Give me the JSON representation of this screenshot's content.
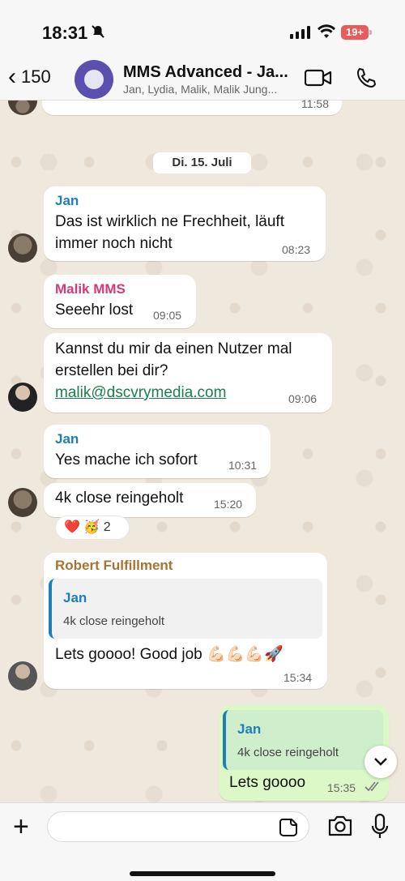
{
  "status": {
    "time": "18:31",
    "battery": "19+"
  },
  "header": {
    "back_count": "150",
    "title": "MMS Advanced - Ja...",
    "subtitle": "Jan, Lydia, Malik, Malik Jung..."
  },
  "top_partial": {
    "time": "11:58"
  },
  "date_chip": "Di. 15. Juli",
  "messages": [
    {
      "sender": "Jan",
      "sender_color": "#1f7fb5",
      "lines": [
        "Das ist wirklich ne Frechheit, läuft",
        "immer noch nicht"
      ],
      "time": "08:23"
    },
    {
      "sender": "Malik MMS",
      "sender_color": "#d13a7a",
      "lines": [
        "Seeehr lost"
      ],
      "time": "09:05"
    },
    {
      "lines": [
        "Kannst du mir da einen Nutzer mal",
        "erstellen bei dir?"
      ],
      "link": "malik@dscvrymedia.com",
      "time": "09:06"
    },
    {
      "sender": "Jan",
      "sender_color": "#1f7fb5",
      "lines": [
        "Yes mache ich sofort"
      ],
      "time": "10:31"
    },
    {
      "lines": [
        "4k close reingeholt"
      ],
      "time": "15:20"
    },
    {
      "sender": "Robert Fulfillment",
      "sender_color": "#a6742e",
      "quote_name": "Jan",
      "quote_text": "4k close reingeholt",
      "text": "Lets goooo! Good job 💪🏻💪🏻💪🏻🚀",
      "time": "15:34"
    },
    {
      "quote_name": "Jan",
      "quote_text": "4k close reingeholt",
      "text": "Lets goooo",
      "time": "15:35"
    }
  ],
  "reactions": {
    "emojis": "❤️ 🥳",
    "count": "2"
  },
  "composer": {
    "placeholder": ""
  }
}
